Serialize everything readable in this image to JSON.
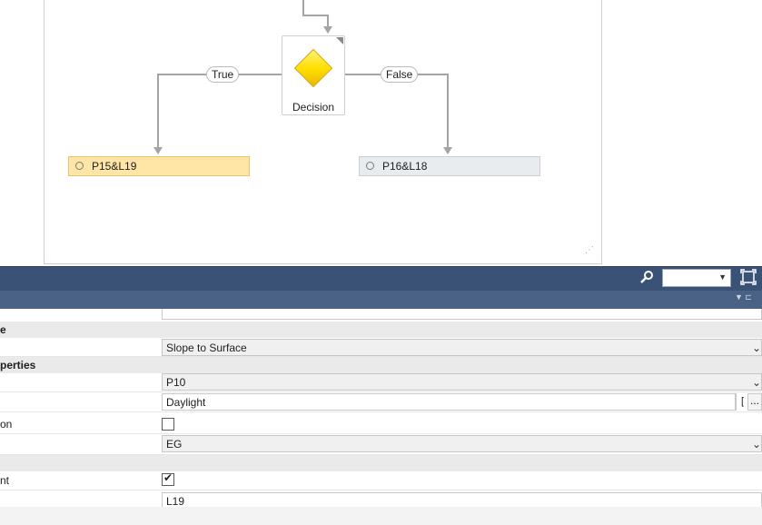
{
  "designer": {
    "decision": {
      "label": "Decision",
      "icon": "diamond-icon"
    },
    "true_label": "True",
    "false_label": "False",
    "true_activity": "P15&L19",
    "false_activity": "P16&L18"
  },
  "toolbar": {
    "search_icon": "magnifier-icon",
    "zoom_value": "",
    "fit_icon": "fit-to-screen-icon"
  },
  "properties": {
    "category_1": "e",
    "row_1_value": "Slope to Surface",
    "category_2": "perties",
    "row_2_value": "P10",
    "row_3_value": "Daylight",
    "row_3_button": "[",
    "row_3_ellipsis": "...",
    "row_4_name": "on",
    "row_5_value": "EG",
    "row_6_name": "nt",
    "row_6_check": "✔",
    "row_7_value": "L19"
  },
  "colors": {
    "toolbar": "#3b5277",
    "true_activity_bg": "#ffe6a6",
    "false_activity_bg": "#e8ecef",
    "decision_fill": "#ffe000"
  }
}
